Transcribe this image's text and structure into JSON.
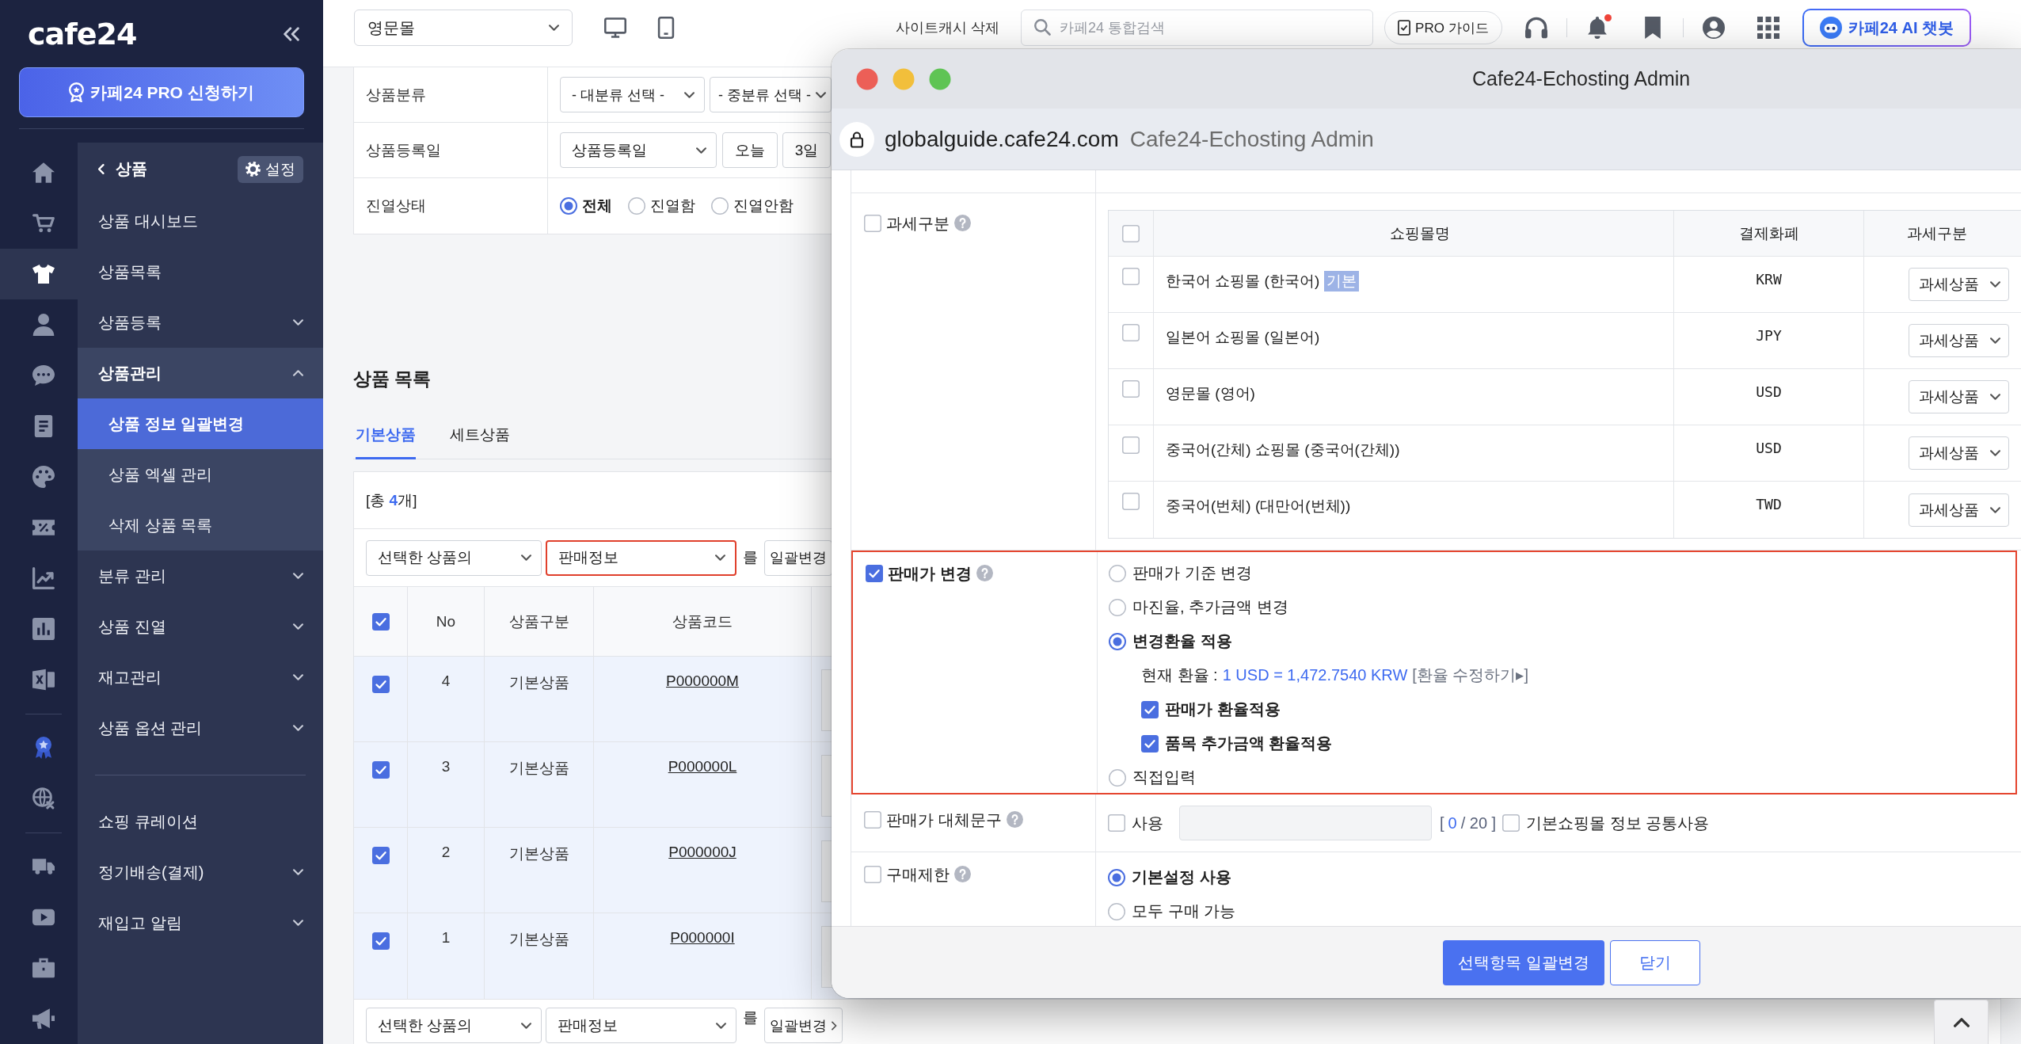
{
  "sidebar": {
    "logo": "cafe24",
    "pro_button": "카페24 PRO 신청하기",
    "rail_groups": [
      [
        {
          "kind": "home",
          "selected": false
        },
        {
          "kind": "cart",
          "selected": false
        },
        {
          "kind": "shirt",
          "selected": true
        },
        {
          "kind": "person",
          "selected": false
        },
        {
          "kind": "chat",
          "selected": false
        },
        {
          "kind": "document",
          "selected": false
        },
        {
          "kind": "palette",
          "selected": false
        },
        {
          "kind": "coupon",
          "selected": false
        },
        {
          "kind": "trend",
          "selected": false
        },
        {
          "kind": "bars",
          "selected": false
        },
        {
          "kind": "sheet",
          "selected": false
        }
      ],
      [
        {
          "kind": "medal",
          "selected": false
        },
        {
          "kind": "globe",
          "selected": false
        }
      ],
      [
        {
          "kind": "truck",
          "selected": false
        },
        {
          "kind": "video",
          "selected": false
        },
        {
          "kind": "briefcase",
          "selected": false
        },
        {
          "kind": "megaphone",
          "selected": false
        }
      ]
    ],
    "section": {
      "title": "상품",
      "settings": "설정"
    },
    "menu_sections": [
      [
        {
          "label": "상품 대시보드",
          "kind": "page",
          "selected": false
        },
        {
          "label": "상품목록",
          "kind": "page",
          "selected": false
        },
        {
          "label": "상품등록",
          "kind": "group",
          "expanded": false,
          "selected": false
        },
        {
          "label": "상품관리",
          "kind": "group",
          "expanded": true,
          "selected": false,
          "children": [
            {
              "label": "상품 정보 일괄변경",
              "selected": true
            },
            {
              "label": "상품 엑셀 관리",
              "selected": false
            },
            {
              "label": "삭제 상품 목록",
              "selected": false
            }
          ]
        },
        {
          "label": "분류 관리",
          "kind": "group",
          "expanded": false,
          "selected": false
        },
        {
          "label": "상품 진열",
          "kind": "group",
          "expanded": false,
          "selected": false
        },
        {
          "label": "재고관리",
          "kind": "group",
          "expanded": false,
          "selected": false
        },
        {
          "label": "상품 옵션 관리",
          "kind": "group",
          "expanded": false,
          "selected": false
        }
      ],
      [
        {
          "label": "쇼핑 큐레이션",
          "kind": "page",
          "selected": false
        },
        {
          "label": "정기배송(결제)",
          "kind": "group",
          "expanded": false,
          "selected": false
        },
        {
          "label": "재입고 알림",
          "kind": "group",
          "expanded": false,
          "selected": false
        }
      ]
    ]
  },
  "top_bar": {
    "mall_select": "영문몰",
    "cache_link": "사이트캐시 삭제",
    "search": {
      "placeholder": "카페24 통합검색"
    },
    "guide_button": "PRO 가이드",
    "notifications": {
      "unread": true
    },
    "chatbot_button": "카페24 AI 챗봇"
  },
  "search_form": [
    {
      "label": "상품분류",
      "kind": "selects",
      "selects": [
        "- 대분류 선택 -",
        "- 중분류 선택 -"
      ]
    },
    {
      "label": "상품등록일",
      "kind": "date",
      "select": "상품등록일",
      "buttons": [
        "오늘",
        "3일"
      ]
    },
    {
      "label": "진열상태",
      "kind": "radios",
      "options": [
        {
          "label": "전체",
          "selected": true
        },
        {
          "label": "진열함",
          "selected": false
        },
        {
          "label": "진열안함",
          "selected": false
        }
      ]
    }
  ],
  "product_list": {
    "title": "상품 목록",
    "tabs": [
      {
        "label": "기본상품",
        "selected": true
      },
      {
        "label": "세트상품",
        "selected": false
      }
    ],
    "total": "[총 **4**개]",
    "bulk_bars": [
      {
        "target": "선택한 상품의",
        "field": "판매정보",
        "highlighted": true,
        "connector": "를",
        "button": "일괄변경",
        "arrow": false
      },
      {
        "target": "선택한 상품의",
        "field": "판매정보",
        "highlighted": false,
        "connector": "를",
        "button": "일괄변경",
        "arrow": true
      }
    ],
    "table": {
      "all_checked": true,
      "columns": [
        "No",
        "상품구분",
        "상품코드"
      ],
      "rows": [
        {
          "checked": true,
          "no": "4",
          "type": "기본상품",
          "code": "P000000M"
        },
        {
          "checked": true,
          "no": "3",
          "type": "기본상품",
          "code": "P000000L"
        },
        {
          "checked": true,
          "no": "2",
          "type": "기본상품",
          "code": "P000000J"
        },
        {
          "checked": true,
          "no": "1",
          "type": "기본상품",
          "code": "P000000I"
        }
      ]
    }
  },
  "modal": {
    "title": "Cafe24-Echosting Admin",
    "url": "globalguide.cafe24.com",
    "page_title": "Cafe24-Echosting Admin",
    "rows": [
      {
        "kind": "tax",
        "label": "과세구분",
        "checked": false,
        "highlighted": false,
        "table": {
          "all_checked": false,
          "columns": [
            "쇼핑몰명",
            "결제화폐",
            "과세구분"
          ],
          "rows": [
            {
              "checked": false,
              "mall": "한국어 쇼핑몰 (한국어)",
              "tag": "기본",
              "currency": "KRW",
              "tax": "과세상품"
            },
            {
              "checked": false,
              "mall": "일본어 쇼핑몰 (일본어)",
              "currency": "JPY",
              "tax": "과세상품"
            },
            {
              "checked": false,
              "mall": "영문몰 (영어)",
              "currency": "USD",
              "tax": "과세상품"
            },
            {
              "checked": false,
              "mall": "중국어(간체) 쇼핑몰 (중국어(간체))",
              "currency": "USD",
              "tax": "과세상품"
            },
            {
              "checked": false,
              "mall": "중국어(번체) (대만어(번체))",
              "currency": "TWD",
              "tax": "과세상품"
            }
          ]
        }
      },
      {
        "kind": "price",
        "label": "판매가 변경",
        "checked": true,
        "highlighted": true,
        "options": [
          {
            "kind": "radio",
            "label": "판매가 기준 변경",
            "selected": false
          },
          {
            "kind": "radio",
            "label": "마진율, 추가금액 변경",
            "selected": false
          },
          {
            "kind": "radio",
            "label": "변경환율 적용",
            "selected": true
          },
          {
            "kind": "rate",
            "label": "현재 환율 :",
            "value": "1 USD = 1,472.7540 KRW",
            "link": "[환율 수정하기▸]"
          },
          {
            "kind": "checkbox",
            "label": "판매가 환율적용",
            "checked": true
          },
          {
            "kind": "checkbox",
            "label": "품목 추가금액 환율적용",
            "checked": true
          },
          {
            "kind": "radio",
            "label": "직접입력",
            "selected": false
          }
        ]
      },
      {
        "kind": "replace",
        "label": "판매가 대체문구",
        "checked": false,
        "highlighted": false,
        "use": {
          "label": "사용",
          "checked": false
        },
        "input": {
          "disabled": true
        },
        "counter": [
          {
            "text": "[",
            "highlight": false
          },
          {
            "text": "0",
            "highlight": true
          },
          {
            "text": "/ 20 ]",
            "highlight": false
          }
        ],
        "shared": {
          "label": "기본쇼핑몰 정보 공통사용",
          "checked": false
        }
      },
      {
        "kind": "limit",
        "label": "구매제한",
        "checked": false,
        "highlighted": false,
        "options": [
          {
            "label": "기본설정 사용",
            "selected": true
          },
          {
            "label": "모두 구매 가능",
            "selected": false
          }
        ]
      }
    ],
    "buttons": [
      {
        "label": "선택항목 일괄변경",
        "kind": "primary"
      },
      {
        "label": "닫기",
        "kind": "secondary"
      }
    ]
  }
}
